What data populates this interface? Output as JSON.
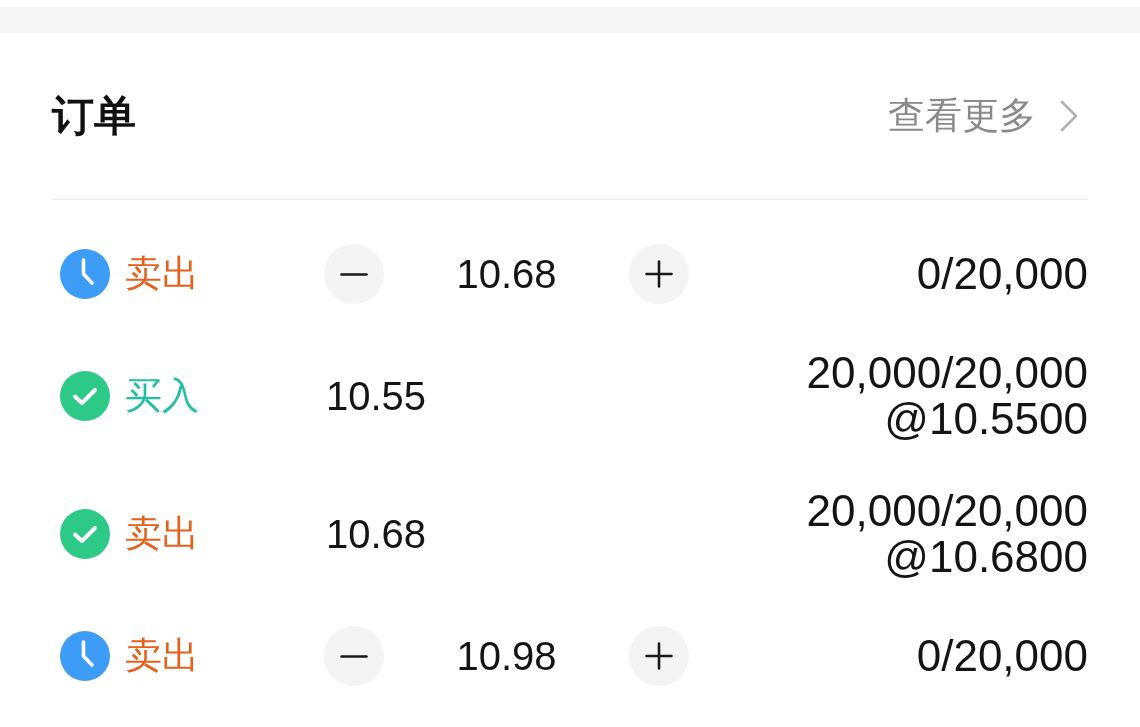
{
  "title": "订单",
  "view_more": {
    "label": "查看更多"
  },
  "orders": [
    {
      "kind": "pending",
      "side_label": "卖出",
      "color": "#e5601a",
      "price": "10.68",
      "quantity": "0/20,000"
    },
    {
      "kind": "filled",
      "side_label": "买入",
      "color": "#22bfa2",
      "price": "10.55",
      "quantity": "20,000/20,000",
      "average_price": "@10.5500"
    },
    {
      "kind": "filled",
      "side_label": "卖出",
      "color": "#e5601a",
      "price": "10.68",
      "quantity": "20,000/20,000",
      "average_price": "@10.6800"
    },
    {
      "kind": "pending",
      "side_label": "卖出",
      "color": "#e5601a",
      "price": "10.98",
      "quantity": "0/20,000"
    }
  ]
}
